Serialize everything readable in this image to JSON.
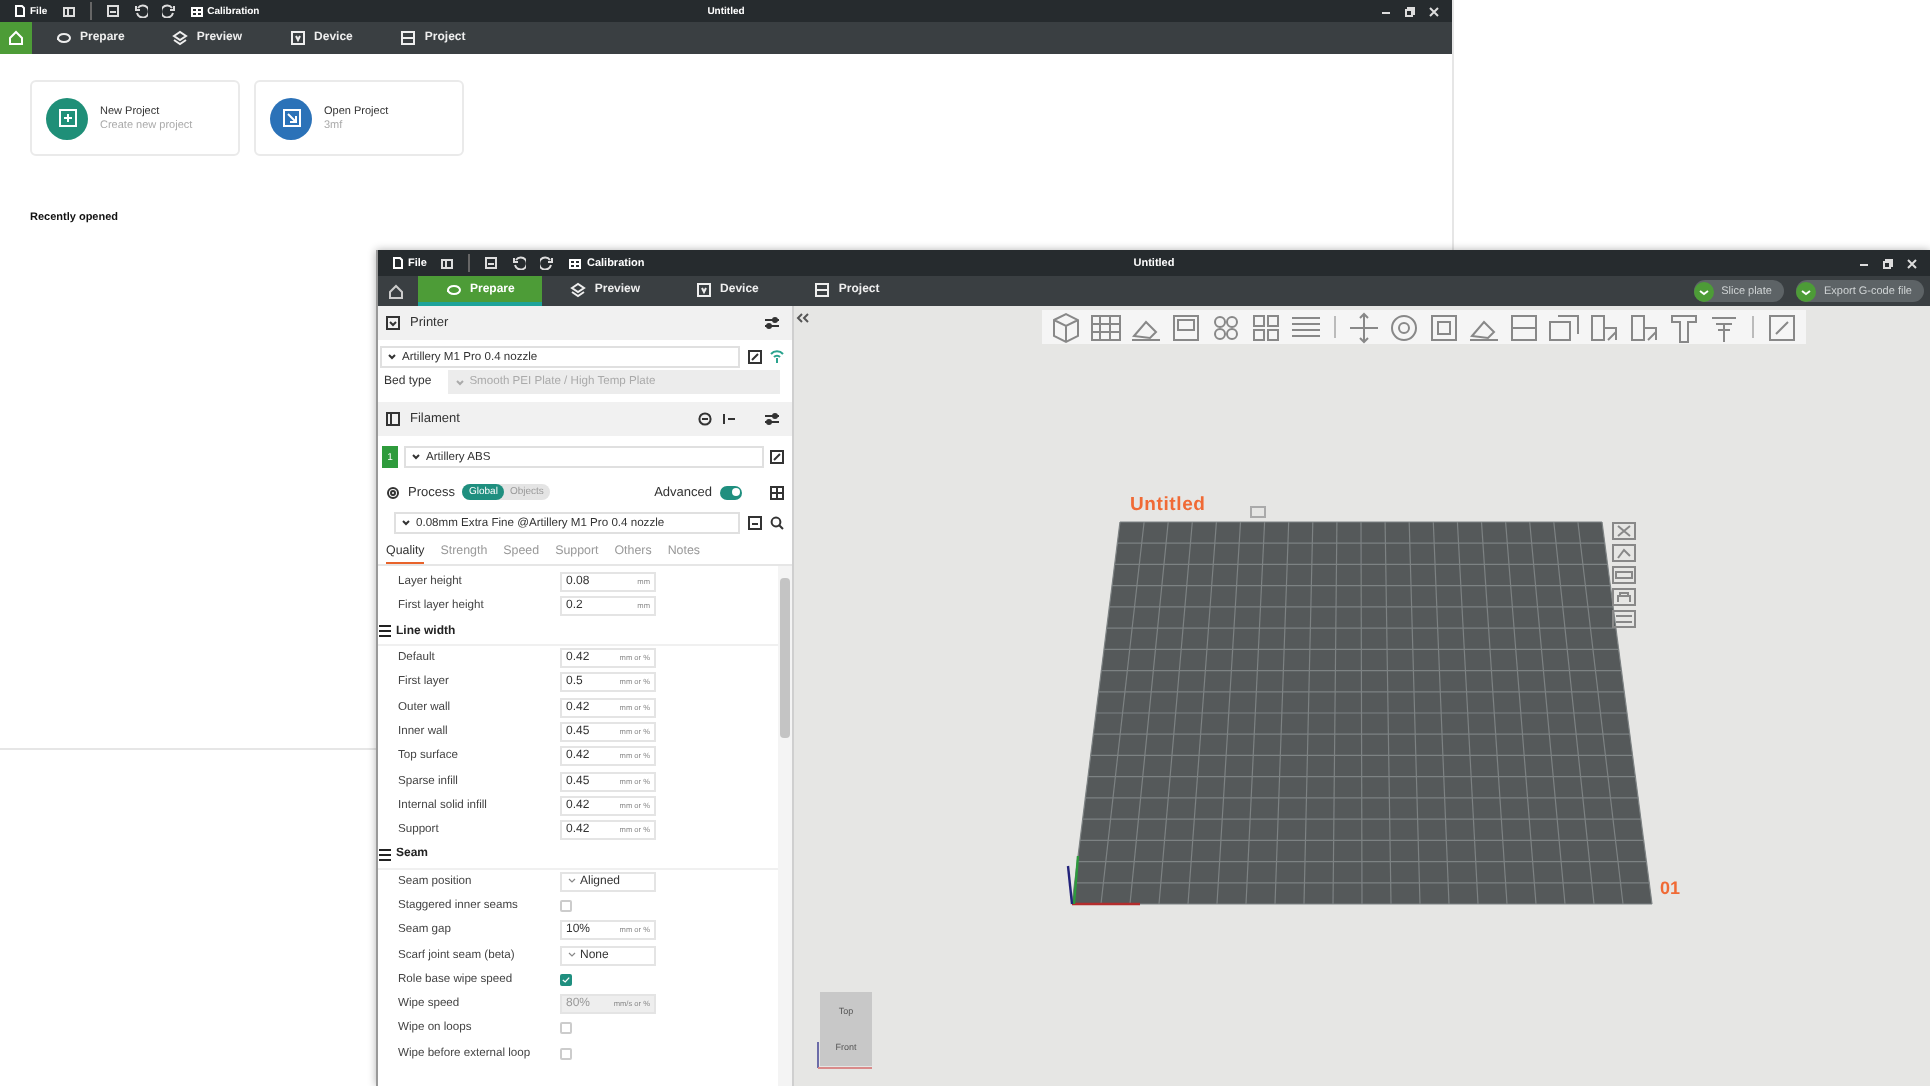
{
  "back_window": {
    "menu_label": "File",
    "toolbar_label": "Calibration",
    "title": "Untitled",
    "home_selected": true,
    "tabs": [
      {
        "label": "Prepare",
        "selected": false
      },
      {
        "label": "Preview",
        "selected": false
      },
      {
        "label": "Device",
        "selected": false
      },
      {
        "label": "Project",
        "selected": false
      }
    ],
    "cards": [
      {
        "kind": "new",
        "title": "New Project",
        "subtitle": "Create new project"
      },
      {
        "kind": "open",
        "title": "Open Project",
        "subtitle": "3mf"
      }
    ],
    "recent_heading": "Recently opened"
  },
  "front_window": {
    "menu_label": "File",
    "toolbar_label": "Calibration",
    "title": "Untitled",
    "home_selected": false,
    "tabs": [
      {
        "label": "Prepare",
        "selected": true
      },
      {
        "label": "Preview",
        "selected": false
      },
      {
        "label": "Device",
        "selected": false
      },
      {
        "label": "Project",
        "selected": false
      }
    ],
    "actions": [
      {
        "label": "Slice plate"
      },
      {
        "label": "Export G-code file"
      }
    ],
    "sidebar": {
      "printer": {
        "title": "Printer",
        "preset": "Artillery M1 Pro 0.4 nozzle",
        "bed_type_label": "Bed type",
        "bed_type": "Smooth PEI Plate / High Temp Plate"
      },
      "filament": {
        "title": "Filament",
        "items": [
          {
            "index": "1",
            "name": "Artillery ABS",
            "color": "#2e9b3c"
          }
        ]
      },
      "process": {
        "title": "Process",
        "scope": [
          {
            "label": "Global",
            "selected": true
          },
          {
            "label": "Objects",
            "selected": false
          }
        ],
        "advanced_label": "Advanced",
        "advanced": true,
        "preset": "0.08mm Extra Fine @Artillery M1 Pro 0.4 nozzle",
        "tabs": [
          {
            "label": "Quality",
            "selected": true
          },
          {
            "label": "Strength",
            "selected": false
          },
          {
            "label": "Speed",
            "selected": false
          },
          {
            "label": "Support",
            "selected": false
          },
          {
            "label": "Others",
            "selected": false
          },
          {
            "label": "Notes",
            "selected": false
          }
        ],
        "settings": [
          {
            "kind": "number",
            "label": "Layer height",
            "value": "0.08",
            "unit": "mm",
            "disabled": false
          },
          {
            "kind": "number",
            "label": "First layer height",
            "value": "0.2",
            "unit": "mm",
            "disabled": false
          },
          {
            "kind": "group",
            "label": "Line width"
          },
          {
            "kind": "number",
            "label": "Default",
            "value": "0.42",
            "unit": "mm or %",
            "disabled": false
          },
          {
            "kind": "number",
            "label": "First layer",
            "value": "0.5",
            "unit": "mm or %",
            "disabled": false
          },
          {
            "kind": "number",
            "label": "Outer wall",
            "value": "0.42",
            "unit": "mm or %",
            "disabled": false
          },
          {
            "kind": "number",
            "label": "Inner wall",
            "value": "0.45",
            "unit": "mm or %",
            "disabled": false
          },
          {
            "kind": "number",
            "label": "Top surface",
            "value": "0.42",
            "unit": "mm or %",
            "disabled": false
          },
          {
            "kind": "number",
            "label": "Sparse infill",
            "value": "0.45",
            "unit": "mm or %",
            "disabled": false
          },
          {
            "kind": "number",
            "label": "Internal solid infill",
            "value": "0.42",
            "unit": "mm or %",
            "disabled": false
          },
          {
            "kind": "number",
            "label": "Support",
            "value": "0.42",
            "unit": "mm or %",
            "disabled": false
          },
          {
            "kind": "group",
            "label": "Seam"
          },
          {
            "kind": "select",
            "label": "Seam position",
            "value": "Aligned"
          },
          {
            "kind": "checkbox",
            "label": "Staggered inner seams",
            "checked": false
          },
          {
            "kind": "number",
            "label": "Seam gap",
            "value": "10%",
            "unit": "mm or %",
            "disabled": false
          },
          {
            "kind": "select",
            "label": "Scarf joint seam (beta)",
            "value": "None"
          },
          {
            "kind": "checkbox",
            "label": "Role base wipe speed",
            "checked": true
          },
          {
            "kind": "number",
            "label": "Wipe speed",
            "value": "80%",
            "unit": "mm/s or %",
            "disabled": true
          },
          {
            "kind": "checkbox",
            "label": "Wipe on loops",
            "checked": false
          },
          {
            "kind": "checkbox",
            "label": "Wipe before external loop",
            "checked": false
          }
        ]
      }
    },
    "viewport": {
      "plate_name": "Untitled",
      "plate_number": "01",
      "cube_labels": [
        "Top",
        "Front"
      ]
    }
  }
}
